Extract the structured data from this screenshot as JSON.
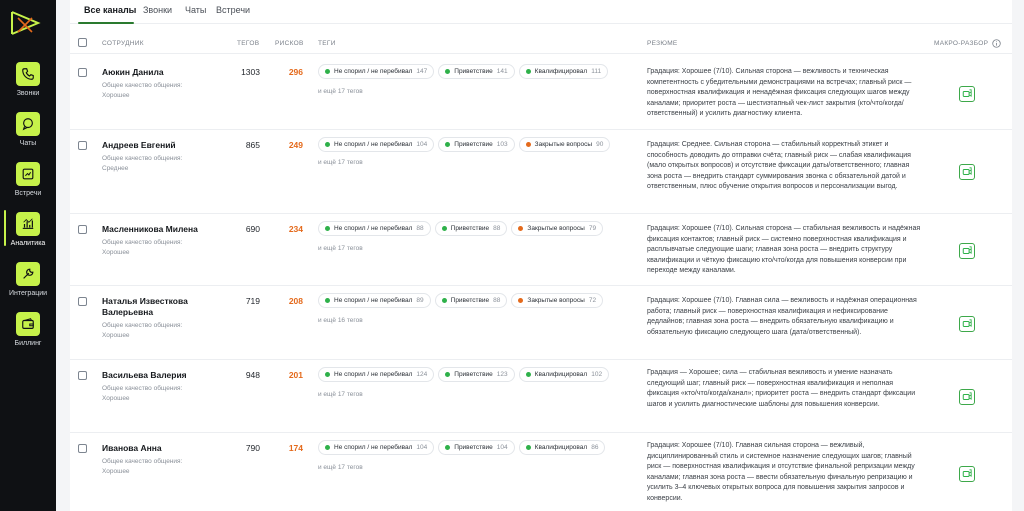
{
  "sidebar": {
    "items": [
      {
        "label": "Звонки",
        "icon": "phone-icon"
      },
      {
        "label": "Чаты",
        "icon": "chat-icon"
      },
      {
        "label": "Встречи",
        "icon": "meeting-icon"
      },
      {
        "label": "Аналитика",
        "icon": "analytics-icon"
      },
      {
        "label": "Интеграции",
        "icon": "wrench-icon"
      },
      {
        "label": "Биллинг",
        "icon": "wallet-icon"
      }
    ]
  },
  "tabs": [
    "Все каналы",
    "Звонки",
    "Чаты",
    "Встречи"
  ],
  "columns": {
    "employee": "СОТРУДНИК",
    "tags": "ТЕГОВ",
    "risks": "РИСКОВ",
    "tag_list": "ТЕГИ",
    "summary": "РЕЗЮМЕ",
    "macro": "МАКРО-РАЗБОР"
  },
  "colors": {
    "accent": "#c6f24a",
    "green": "#2fb14a",
    "orange": "#e46a1c"
  },
  "rows": [
    {
      "name": "Аюкин Данила",
      "sub1": "Общее качество общения:",
      "sub2": "Хорошее",
      "tags_count": "1303",
      "risks_count": "296",
      "tags": [
        {
          "label": "Не спорил / не перебивал",
          "count": "147",
          "color": "#2fb14a"
        },
        {
          "label": "Приветствие",
          "count": "141",
          "color": "#2fb14a"
        },
        {
          "label": "Квалифицировал",
          "count": "111",
          "color": "#2fb14a"
        }
      ],
      "more": "и ещё 17 тегов",
      "summary": "Градация: Хорошее (7/10). Сильная сторона — вежливость и техническая компетентность с убедительными демонстрациями на встречах; главный риск — поверхностная квалификация и ненадёжная фиксация следующих шагов между каналами; приоритет роста — шестиэтапный чек-лист закрытия (кто/что/когда/ответственный) и усилить диагностику клиента."
    },
    {
      "name": "Андреев Евгений",
      "sub1": "Общее качество общения:",
      "sub2": "Среднее",
      "tags_count": "865",
      "risks_count": "249",
      "tags": [
        {
          "label": "Не спорил / не перебивал",
          "count": "104",
          "color": "#2fb14a"
        },
        {
          "label": "Приветствие",
          "count": "103",
          "color": "#2fb14a"
        },
        {
          "label": "Закрытые вопросы",
          "count": "90",
          "color": "#e46a1c"
        }
      ],
      "more": "и ещё 17 тегов",
      "summary": "Градация: Среднее. Сильная сторона — стабильный корректный этикет и способность доводить до отправки счёта; главный риск — слабая квалификация (мало открытых вопросов) и отсутствие фиксации даты/ответственного; главная зона роста — внедрить стандарт суммирования звонка с обязательной датой и ответственным, плюс обучение открытия вопросов и персонализации выгод."
    },
    {
      "name": "Масленникова Милена",
      "sub1": "Общее качество общения:",
      "sub2": "Хорошее",
      "tags_count": "690",
      "risks_count": "234",
      "tags": [
        {
          "label": "Не спорил / не перебивал",
          "count": "88",
          "color": "#2fb14a"
        },
        {
          "label": "Приветствие",
          "count": "88",
          "color": "#2fb14a"
        },
        {
          "label": "Закрытые вопросы",
          "count": "79",
          "color": "#e46a1c"
        }
      ],
      "more": "и ещё 17 тегов",
      "summary": "Градация: Хорошее (7/10). Сильная сторона — стабильная вежливость и надёжная фиксация контактов; главный риск — системно поверхностная квалификация и расплывчатые следующие шаги; главная зона роста — внедрить структуру квалификации и чёткую фиксацию кто/что/когда для повышения конверсии при переходе между каналами."
    },
    {
      "name": "Наталья Известкова Валерьевна",
      "sub1": "Общее качество общения:",
      "sub2": "Хорошее",
      "tags_count": "719",
      "risks_count": "208",
      "tags": [
        {
          "label": "Не спорил / не перебивал",
          "count": "89",
          "color": "#2fb14a"
        },
        {
          "label": "Приветствие",
          "count": "88",
          "color": "#2fb14a"
        },
        {
          "label": "Закрытые вопросы",
          "count": "72",
          "color": "#e46a1c"
        }
      ],
      "more": "и ещё 16 тегов",
      "summary": "Градация: Хорошее (7/10). Главная сила — вежливость и надёжная операционная работа; главный риск — поверхностная квалификация и нефиксирование дедлайнов; главная зона роста — внедрить обязательную квалификацию и обязательную фиксацию следующего шага (дата/ответственный)."
    },
    {
      "name": "Васильева Валерия",
      "sub1": "Общее качество общения:",
      "sub2": "Хорошее",
      "tags_count": "948",
      "risks_count": "201",
      "tags": [
        {
          "label": "Не спорил / не перебивал",
          "count": "124",
          "color": "#2fb14a"
        },
        {
          "label": "Приветствие",
          "count": "123",
          "color": "#2fb14a"
        },
        {
          "label": "Квалифицировал",
          "count": "102",
          "color": "#2fb14a"
        }
      ],
      "more": "и ещё 17 тегов",
      "summary": "Градация — Хорошее; сила — стабильная вежливость и умение назначать следующий шаг; главный риск — поверхностная квалификация и неполная фиксация «кто/что/когда/канал»; приоритет роста — внедрить стандарт фиксации шагов и усилить диагностические шаблоны для повышения конверсии."
    },
    {
      "name": "Иванова Анна",
      "sub1": "Общее качество общения:",
      "sub2": "Хорошее",
      "tags_count": "790",
      "risks_count": "174",
      "tags": [
        {
          "label": "Не спорил / не перебивал",
          "count": "104",
          "color": "#2fb14a"
        },
        {
          "label": "Приветствие",
          "count": "104",
          "color": "#2fb14a"
        },
        {
          "label": "Квалифицировал",
          "count": "86",
          "color": "#2fb14a"
        }
      ],
      "more": "и ещё 17 тегов",
      "summary": "Градация: Хорошее (7/10). Главная сильная сторона — вежливый, дисциплинированный стиль и системное назначение следующих шагов; главный риск — поверхностная квалификация и отсутствие финальной репризации между каналами; главная зона роста — ввести обязательную финальную репризацию и усилить 3–4 ключевых открытых вопроса для повышения закрытия запросов и конверсии."
    }
  ]
}
